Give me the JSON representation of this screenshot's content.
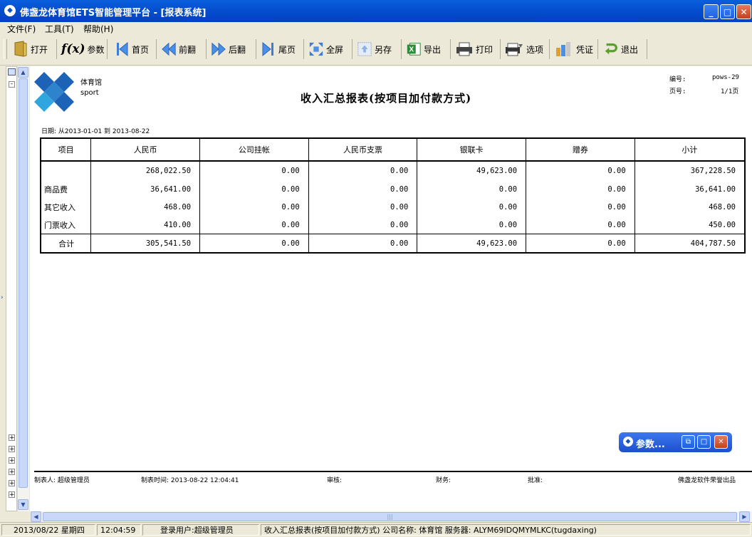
{
  "window": {
    "title": "佛盏龙体育馆ETS智能管理平台 - [报表系统]",
    "min_glyph": "_",
    "max_glyph": "□",
    "close_glyph": "✕"
  },
  "menu": [
    {
      "label": "文件(F)"
    },
    {
      "label": "工具(T)"
    },
    {
      "label": "帮助(H)"
    }
  ],
  "toolbar": [
    {
      "label": "打开",
      "icon": "folder-icon"
    },
    {
      "label": "参数",
      "icon": "function-icon",
      "glyph": "f(x)"
    },
    {
      "label": "首页",
      "icon": "first-page-icon"
    },
    {
      "label": "前翻",
      "icon": "prev-page-icon"
    },
    {
      "label": "后翻",
      "icon": "next-page-icon"
    },
    {
      "label": "尾页",
      "icon": "last-page-icon"
    },
    {
      "label": "全屏",
      "icon": "fullscreen-icon"
    },
    {
      "label": "另存",
      "icon": "save-as-icon"
    },
    {
      "label": "导出",
      "icon": "excel-export-icon"
    },
    {
      "label": "打印",
      "icon": "printer-icon"
    },
    {
      "label": "选项",
      "icon": "print-options-icon"
    },
    {
      "label": "凭证",
      "icon": "voucher-icon"
    },
    {
      "label": "退出",
      "icon": "exit-icon"
    }
  ],
  "report": {
    "logo_line1": "体育馆",
    "logo_line2": "sport",
    "title": "收入汇总报表(按项目加付款方式)",
    "number_label": "编号:",
    "number_value": "pows-29",
    "page_label": "页号:",
    "page_value": "1/1页",
    "date_range": "日期: 从2013-01-01 到 2013-08-22",
    "columns": [
      "项目",
      "人民币",
      "公司挂帐",
      "人民币支票",
      "银联卡",
      "赠券",
      "小计"
    ],
    "rows": [
      {
        "name": "",
        "rmb": "268,022.50",
        "company": "0.00",
        "check": "0.00",
        "unionpay": "49,623.00",
        "coupon": "0.00",
        "subtotal": "367,228.50"
      },
      {
        "name": "商品费",
        "rmb": "36,641.00",
        "company": "0.00",
        "check": "0.00",
        "unionpay": "0.00",
        "coupon": "0.00",
        "subtotal": "36,641.00"
      },
      {
        "name": "其它收入",
        "rmb": "468.00",
        "company": "0.00",
        "check": "0.00",
        "unionpay": "0.00",
        "coupon": "0.00",
        "subtotal": "468.00"
      },
      {
        "name": "门票收入",
        "rmb": "410.00",
        "company": "0.00",
        "check": "0.00",
        "unionpay": "0.00",
        "coupon": "0.00",
        "subtotal": "450.00"
      }
    ],
    "total": {
      "name": "合计",
      "rmb": "305,541.50",
      "company": "0.00",
      "check": "0.00",
      "unionpay": "49,623.00",
      "coupon": "0.00",
      "subtotal": "404,787.50"
    },
    "footer": {
      "maker": "制表人: 超级管理员",
      "made_time": "制表时间: 2013-08-22 12:04:41",
      "audit": "审核:",
      "finance": "财务:",
      "approve": "批准:",
      "brand": "佛盏龙软件荣誉出品"
    }
  },
  "param_window": {
    "title": "参数..."
  },
  "status": {
    "date": "2013/08/22 星期四",
    "time": "12:04:59",
    "user": "登录用户:超级管理员",
    "info": "收入汇总报表(按项目加付款方式) 公司名称: 体育馆 服务器: ALYM69IDQMYMLKC(tugdaxing)"
  },
  "colors": {
    "titlebar": "#0550D0",
    "chrome": "#ECE9D8",
    "logo_blue": "#1C63B8",
    "logo_cyan": "#2FA6DE"
  }
}
